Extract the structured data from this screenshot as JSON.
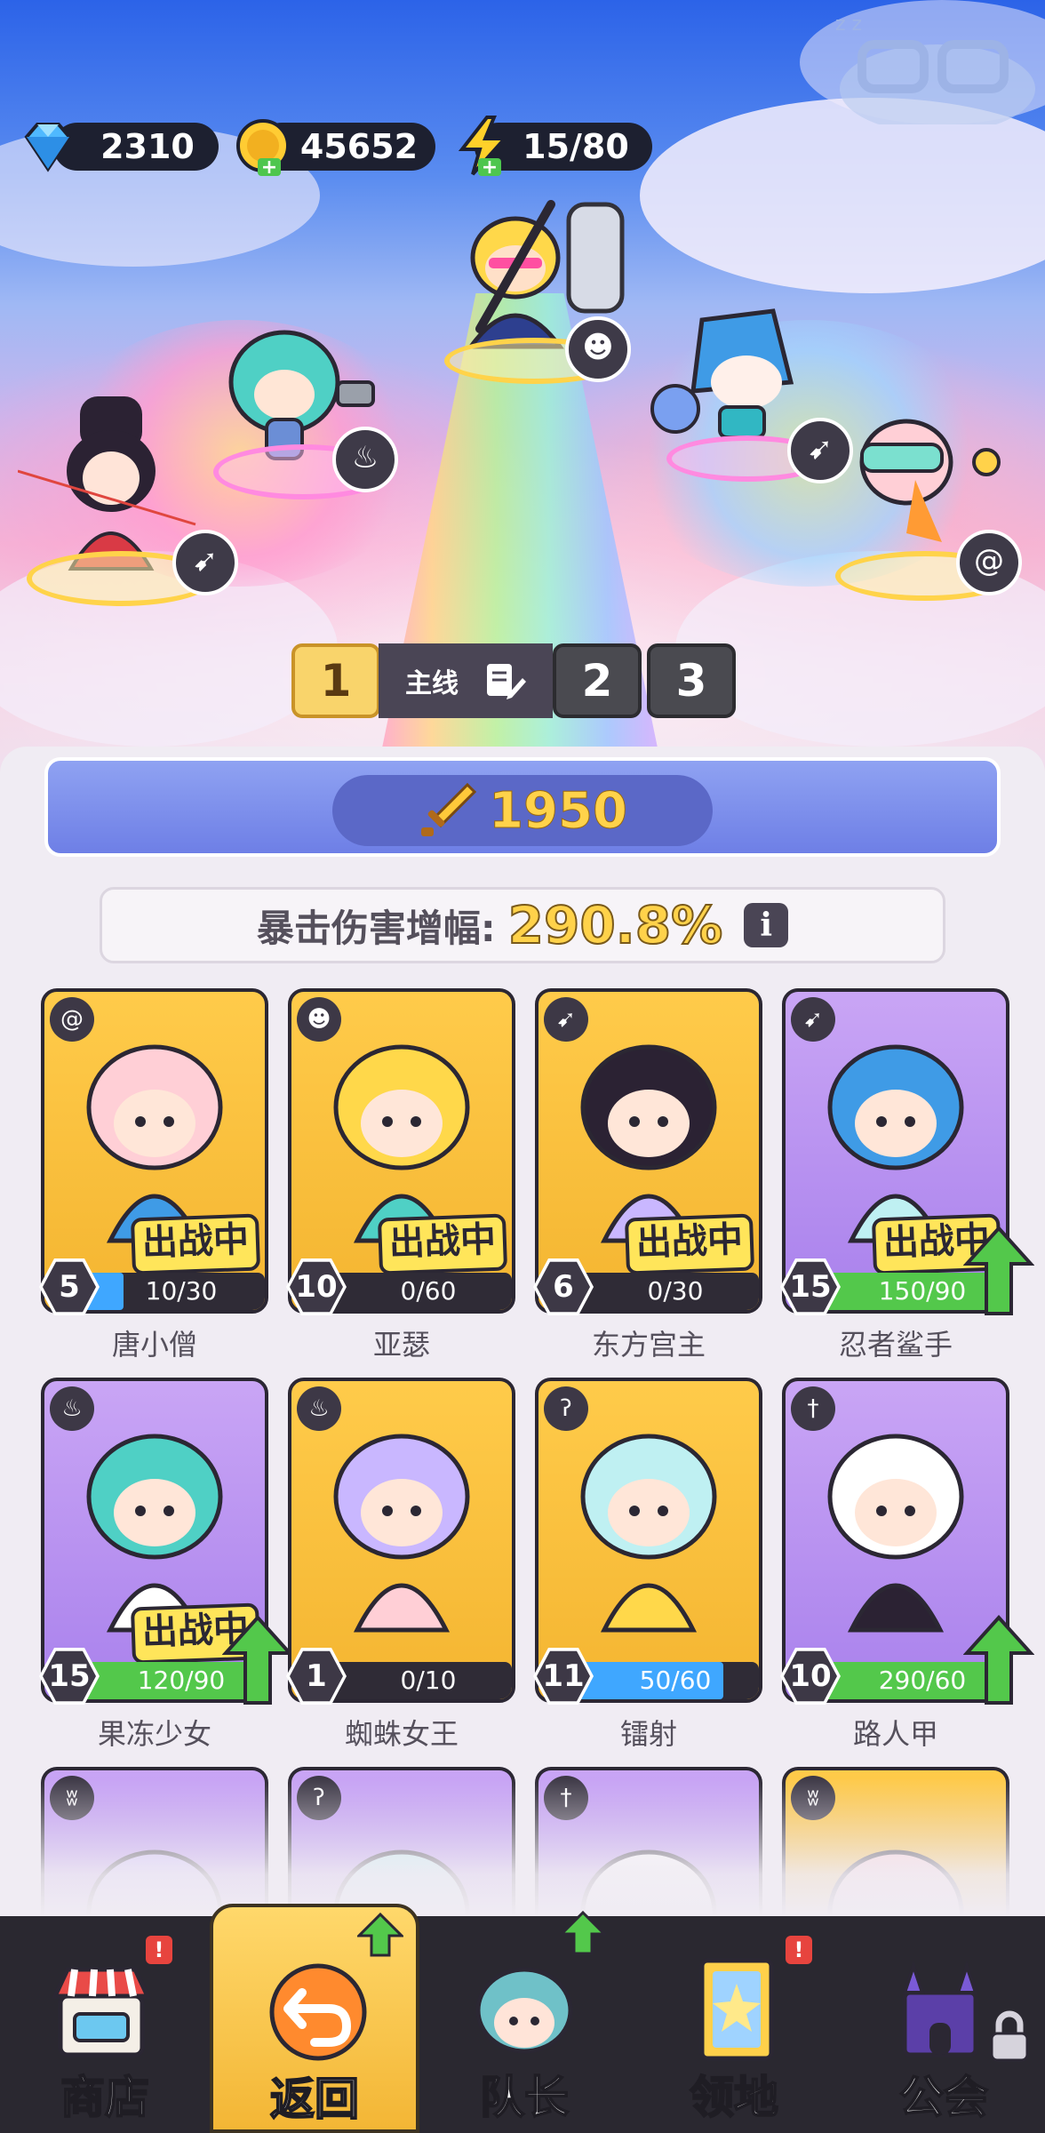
{
  "resources": {
    "gems": "2310",
    "gold": "45652",
    "energy": "15/80"
  },
  "team_selector": {
    "team1": "1",
    "mode_label": "主线",
    "team2": "2",
    "team3": "3"
  },
  "panel": {
    "power": "1950",
    "crit_label": "暴击伤害增幅:",
    "crit_value": "290.8%",
    "info": "i"
  },
  "cards": [
    {
      "name": "唐小僧",
      "level": "5",
      "progress_text": "10/30",
      "progress_ratio": 0.33,
      "deploy_label": "出战中",
      "class_icon": "spiral-icon",
      "rarity": "gold",
      "bar": "blue"
    },
    {
      "name": "亚瑟",
      "level": "10",
      "progress_text": "0/60",
      "progress_ratio": 0,
      "deploy_label": "出战中",
      "class_icon": "cat-mask-icon",
      "rarity": "gold",
      "bar": "blue"
    },
    {
      "name": "东方宫主",
      "level": "6",
      "progress_text": "0/30",
      "progress_ratio": 0,
      "deploy_label": "出战中",
      "class_icon": "bow-icon",
      "rarity": "gold",
      "bar": "blue"
    },
    {
      "name": "忍者鲨手",
      "level": "15",
      "progress_text": "150/90",
      "progress_ratio": 1,
      "deploy_label": "出战中",
      "class_icon": "bow-icon",
      "rarity": "purple",
      "bar": "green",
      "upgrade": true
    },
    {
      "name": "果冻少女",
      "level": "15",
      "progress_text": "120/90",
      "progress_ratio": 1,
      "deploy_label": "出战中",
      "class_icon": "potion-icon",
      "rarity": "purple",
      "bar": "green",
      "upgrade": true
    },
    {
      "name": "蜘蛛女王",
      "level": "1",
      "progress_text": "0/10",
      "progress_ratio": 0,
      "deploy_label": "",
      "class_icon": "potion-icon",
      "rarity": "gold",
      "bar": "blue"
    },
    {
      "name": "镭射",
      "level": "11",
      "progress_text": "50/60",
      "progress_ratio": 0.83,
      "deploy_label": "",
      "class_icon": "hook-icon",
      "rarity": "gold",
      "bar": "blue"
    },
    {
      "name": "路人甲",
      "level": "10",
      "progress_text": "290/60",
      "progress_ratio": 1,
      "deploy_label": "",
      "class_icon": "sword-icon",
      "rarity": "purple",
      "bar": "green",
      "upgrade": true
    }
  ],
  "partial_cards": [
    {
      "class_icon": "wings-icon",
      "rarity": "purple"
    },
    {
      "class_icon": "hook-icon",
      "rarity": "purple"
    },
    {
      "class_icon": "sword-icon",
      "rarity": "purple"
    },
    {
      "class_icon": "wings-icon",
      "rarity": "gold"
    }
  ],
  "nav": {
    "shop": "商店",
    "back": "返回",
    "captain": "队长",
    "territory": "领地",
    "guild": "公会",
    "alert": "!"
  },
  "colors": {
    "gold_card": "#f4b531",
    "purple_card": "#a981ec",
    "progress_blue": "#3fa7ff",
    "progress_green": "#53c84b",
    "accent_yellow": "#ffd24a"
  }
}
